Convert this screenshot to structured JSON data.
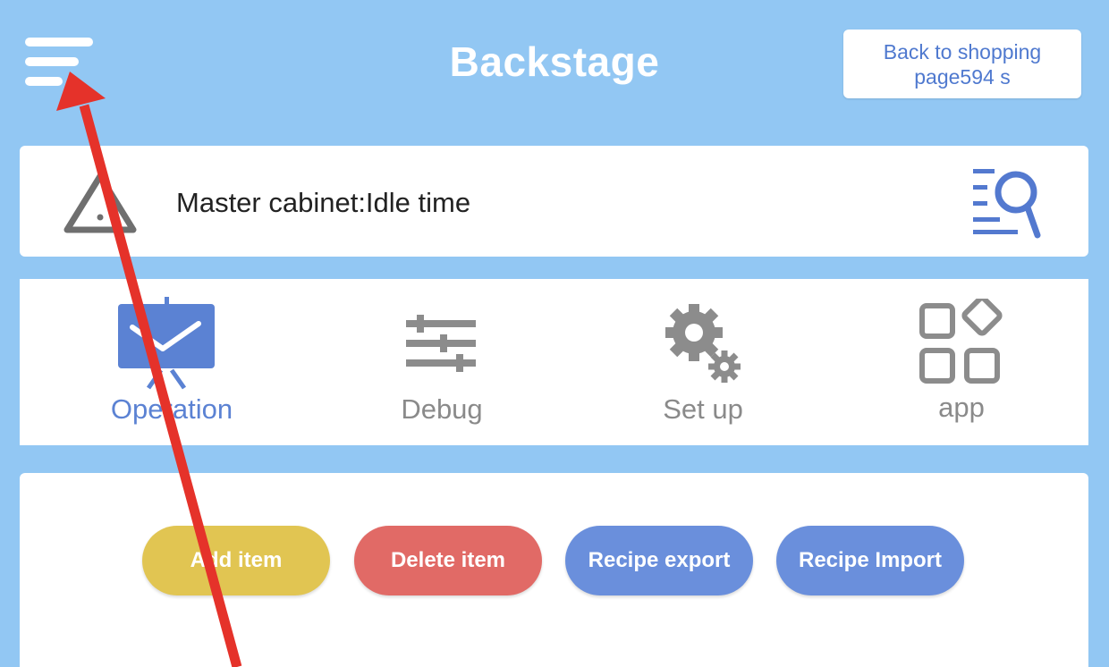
{
  "header": {
    "title": "Backstage",
    "back_button": {
      "line1": "Back to shopping",
      "line2": "page594 s"
    }
  },
  "status": {
    "text": "Master cabinet:Idle time",
    "warning_icon": "warning-triangle-icon",
    "search_icon": "list-search-icon"
  },
  "tabs": [
    {
      "label": "Operation",
      "icon": "presentation-board-icon",
      "active": true
    },
    {
      "label": "Debug",
      "icon": "sliders-icon",
      "active": false
    },
    {
      "label": "Set up",
      "icon": "gears-icon",
      "active": false
    },
    {
      "label": "app",
      "icon": "apps-grid-icon",
      "active": false
    }
  ],
  "actions": [
    {
      "label": "Add item",
      "color": "#e1c552"
    },
    {
      "label": "Delete item",
      "color": "#e16a66"
    },
    {
      "label": "Recipe export",
      "color": "#6a8fdc"
    },
    {
      "label": "Recipe Import",
      "color": "#6a8fdc"
    }
  ],
  "colors": {
    "background": "#92c7f3",
    "accent": "#5b82d3",
    "annotation_arrow": "#e5322a"
  }
}
